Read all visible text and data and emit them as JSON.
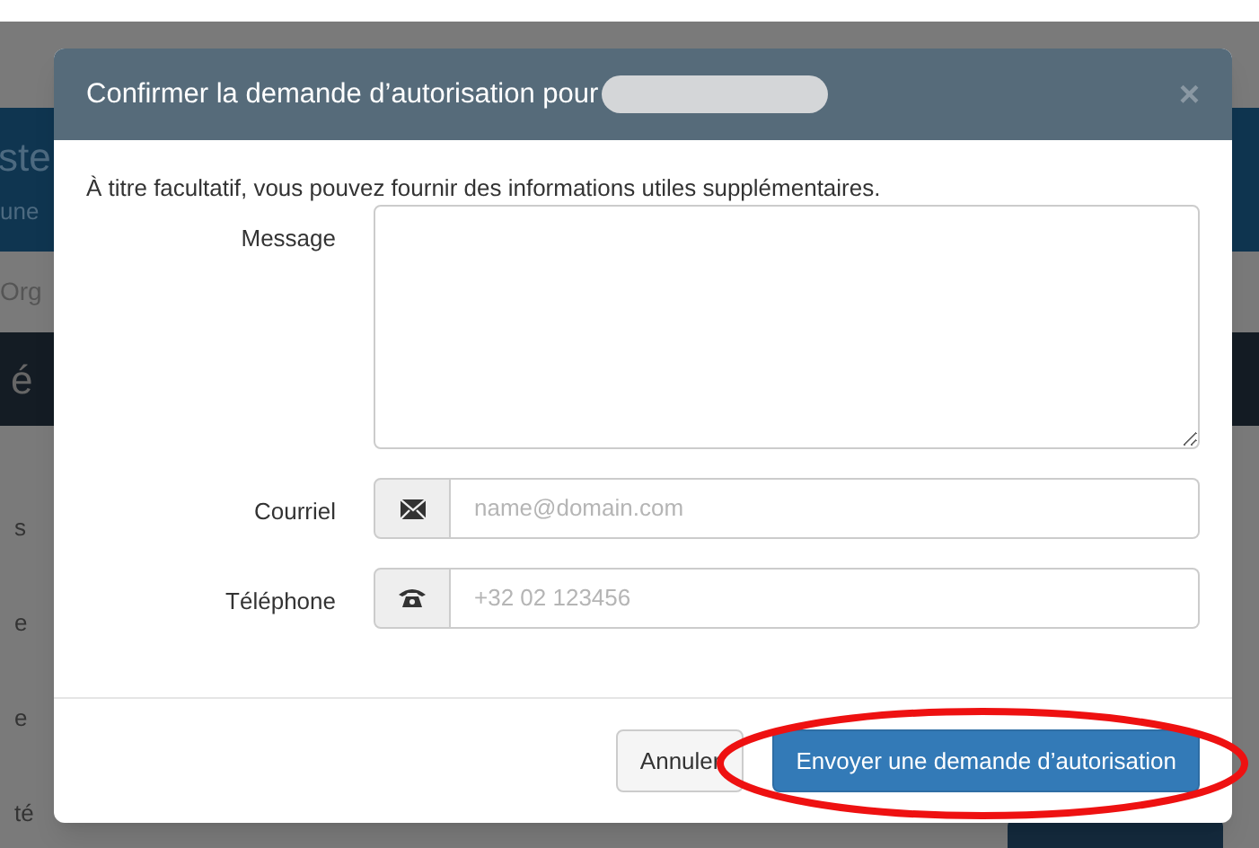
{
  "background": {
    "header_fragments": [
      "ste",
      "une"
    ],
    "breadcrumb_fragment": "Org",
    "banner_fragment": "é",
    "row_fragments": [
      "s",
      "e",
      "e",
      "té"
    ]
  },
  "dialog": {
    "title": "Confirmer la demande d’autorisation pour",
    "close": "×",
    "intro": "À titre facultatif, vous pouvez fournir des informations utiles supplémentaires.",
    "fields": [
      {
        "kind": "textarea",
        "label": "Message"
      },
      {
        "kind": "email",
        "label": "Courriel",
        "placeholder": "name@domain.com"
      },
      {
        "kind": "phone",
        "label": "Téléphone",
        "placeholder": "+32 02 123456"
      }
    ],
    "buttons": [
      {
        "label": "Annuler",
        "kind": "default"
      },
      {
        "label": "Envoyer une demande d’autorisation",
        "kind": "primary"
      }
    ]
  }
}
